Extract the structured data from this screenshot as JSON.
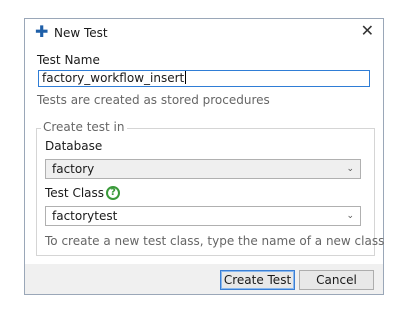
{
  "window": {
    "title": "New Test"
  },
  "form": {
    "test_name_label": "Test Name",
    "test_name_value": "factory_workflow_insert",
    "test_name_hint": "Tests are created as stored procedures",
    "group_title": "Create test in",
    "database_label": "Database",
    "database_value": "factory",
    "test_class_label": "Test Class",
    "test_class_value": "factorytest",
    "test_class_hint": "To create a new test class, type the name of a new class"
  },
  "buttons": {
    "create": "Create Test",
    "cancel": "Cancel"
  },
  "icons": {
    "title": "plus-icon",
    "close": "close-icon",
    "help": "help-icon",
    "dropdown": "chevron-down-icon"
  },
  "symbols": {
    "plus": "✚",
    "close": "✕",
    "help": "?",
    "chevron": "⌄"
  },
  "colors": {
    "accent": "#2f7dd6",
    "help": "#3a9a3a",
    "footer": "#f0f0f0"
  }
}
